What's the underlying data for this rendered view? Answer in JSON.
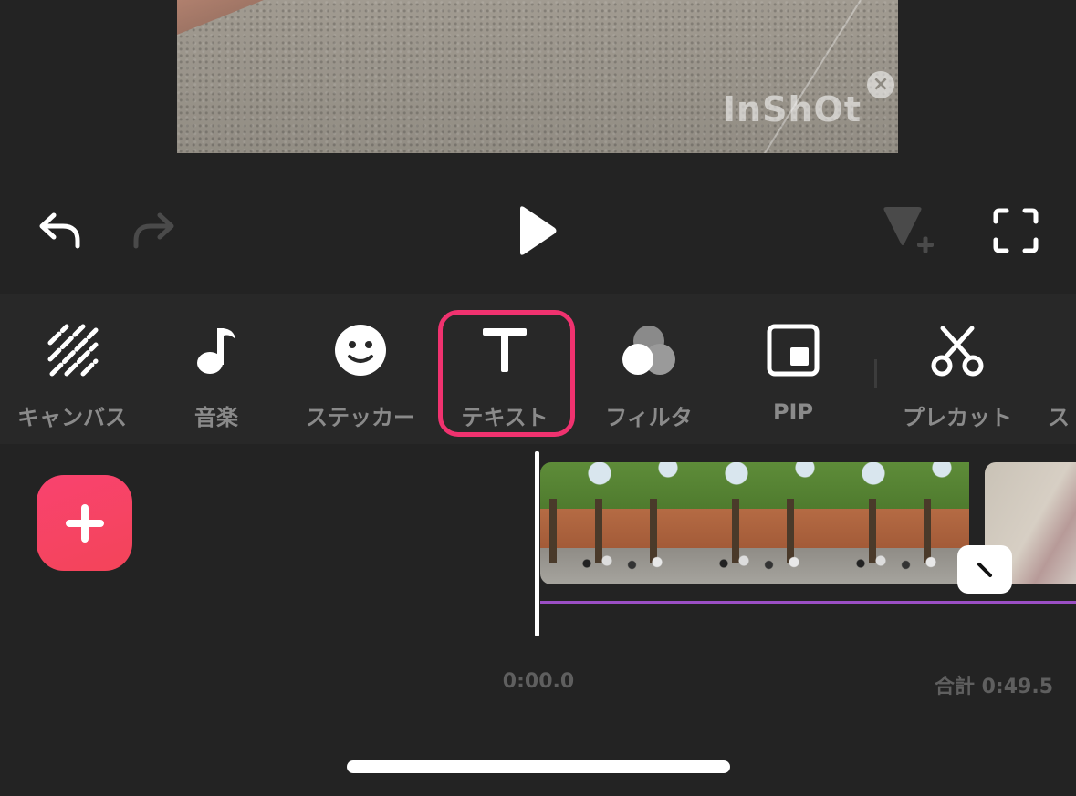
{
  "preview": {
    "watermark_text": "InShOt",
    "watermark_close_glyph": "×"
  },
  "controls": {
    "undo_icon": "undo-arrow-icon",
    "redo_icon": "redo-arrow-icon",
    "play_icon": "play-icon",
    "keyframe_icon": "keyframe-add-icon",
    "fullscreen_icon": "fullscreen-icon"
  },
  "toolbar": {
    "items": [
      {
        "label": "キャンバス",
        "icon": "canvas-stripes-icon"
      },
      {
        "label": "音楽",
        "icon": "music-note-icon"
      },
      {
        "label": "ステッカー",
        "icon": "smiley-icon"
      },
      {
        "label": "テキスト",
        "icon": "text-t-icon",
        "selected": true
      },
      {
        "label": "フィルタ",
        "icon": "filter-circles-icon"
      },
      {
        "label": "PIP",
        "icon": "pip-icon"
      },
      {
        "label": "プレカット",
        "icon": "scissors-icon"
      },
      {
        "label": "ス",
        "icon": "partial-next-tool"
      }
    ],
    "selected_color": "#f0326f"
  },
  "timeline": {
    "add_clip_glyph": "+",
    "current_time": "0:00.0",
    "total_time": "合計 0:49.5",
    "audio_line_color": "#9b4fc5"
  },
  "colors": {
    "background": "#232323",
    "toolbar_bg": "#282828",
    "label_gray": "#8a8a8a",
    "accent_pink": "#f34459"
  }
}
